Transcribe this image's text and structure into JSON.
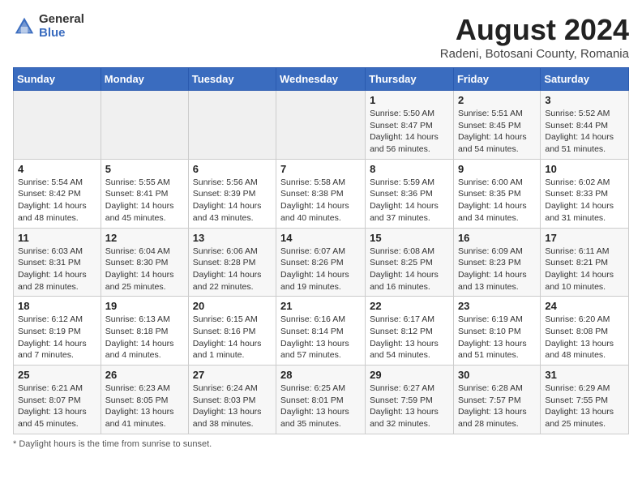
{
  "header": {
    "logo_general": "General",
    "logo_blue": "Blue",
    "main_title": "August 2024",
    "subtitle": "Radeni, Botosani County, Romania"
  },
  "footer": {
    "note": "Daylight hours"
  },
  "calendar": {
    "columns": [
      "Sunday",
      "Monday",
      "Tuesday",
      "Wednesday",
      "Thursday",
      "Friday",
      "Saturday"
    ],
    "weeks": [
      [
        {
          "day": "",
          "info": ""
        },
        {
          "day": "",
          "info": ""
        },
        {
          "day": "",
          "info": ""
        },
        {
          "day": "",
          "info": ""
        },
        {
          "day": "1",
          "info": "Sunrise: 5:50 AM\nSunset: 8:47 PM\nDaylight: 14 hours\nand 56 minutes."
        },
        {
          "day": "2",
          "info": "Sunrise: 5:51 AM\nSunset: 8:45 PM\nDaylight: 14 hours\nand 54 minutes."
        },
        {
          "day": "3",
          "info": "Sunrise: 5:52 AM\nSunset: 8:44 PM\nDaylight: 14 hours\nand 51 minutes."
        }
      ],
      [
        {
          "day": "4",
          "info": "Sunrise: 5:54 AM\nSunset: 8:42 PM\nDaylight: 14 hours\nand 48 minutes."
        },
        {
          "day": "5",
          "info": "Sunrise: 5:55 AM\nSunset: 8:41 PM\nDaylight: 14 hours\nand 45 minutes."
        },
        {
          "day": "6",
          "info": "Sunrise: 5:56 AM\nSunset: 8:39 PM\nDaylight: 14 hours\nand 43 minutes."
        },
        {
          "day": "7",
          "info": "Sunrise: 5:58 AM\nSunset: 8:38 PM\nDaylight: 14 hours\nand 40 minutes."
        },
        {
          "day": "8",
          "info": "Sunrise: 5:59 AM\nSunset: 8:36 PM\nDaylight: 14 hours\nand 37 minutes."
        },
        {
          "day": "9",
          "info": "Sunrise: 6:00 AM\nSunset: 8:35 PM\nDaylight: 14 hours\nand 34 minutes."
        },
        {
          "day": "10",
          "info": "Sunrise: 6:02 AM\nSunset: 8:33 PM\nDaylight: 14 hours\nand 31 minutes."
        }
      ],
      [
        {
          "day": "11",
          "info": "Sunrise: 6:03 AM\nSunset: 8:31 PM\nDaylight: 14 hours\nand 28 minutes."
        },
        {
          "day": "12",
          "info": "Sunrise: 6:04 AM\nSunset: 8:30 PM\nDaylight: 14 hours\nand 25 minutes."
        },
        {
          "day": "13",
          "info": "Sunrise: 6:06 AM\nSunset: 8:28 PM\nDaylight: 14 hours\nand 22 minutes."
        },
        {
          "day": "14",
          "info": "Sunrise: 6:07 AM\nSunset: 8:26 PM\nDaylight: 14 hours\nand 19 minutes."
        },
        {
          "day": "15",
          "info": "Sunrise: 6:08 AM\nSunset: 8:25 PM\nDaylight: 14 hours\nand 16 minutes."
        },
        {
          "day": "16",
          "info": "Sunrise: 6:09 AM\nSunset: 8:23 PM\nDaylight: 14 hours\nand 13 minutes."
        },
        {
          "day": "17",
          "info": "Sunrise: 6:11 AM\nSunset: 8:21 PM\nDaylight: 14 hours\nand 10 minutes."
        }
      ],
      [
        {
          "day": "18",
          "info": "Sunrise: 6:12 AM\nSunset: 8:19 PM\nDaylight: 14 hours\nand 7 minutes."
        },
        {
          "day": "19",
          "info": "Sunrise: 6:13 AM\nSunset: 8:18 PM\nDaylight: 14 hours\nand 4 minutes."
        },
        {
          "day": "20",
          "info": "Sunrise: 6:15 AM\nSunset: 8:16 PM\nDaylight: 14 hours\nand 1 minute."
        },
        {
          "day": "21",
          "info": "Sunrise: 6:16 AM\nSunset: 8:14 PM\nDaylight: 13 hours\nand 57 minutes."
        },
        {
          "day": "22",
          "info": "Sunrise: 6:17 AM\nSunset: 8:12 PM\nDaylight: 13 hours\nand 54 minutes."
        },
        {
          "day": "23",
          "info": "Sunrise: 6:19 AM\nSunset: 8:10 PM\nDaylight: 13 hours\nand 51 minutes."
        },
        {
          "day": "24",
          "info": "Sunrise: 6:20 AM\nSunset: 8:08 PM\nDaylight: 13 hours\nand 48 minutes."
        }
      ],
      [
        {
          "day": "25",
          "info": "Sunrise: 6:21 AM\nSunset: 8:07 PM\nDaylight: 13 hours\nand 45 minutes."
        },
        {
          "day": "26",
          "info": "Sunrise: 6:23 AM\nSunset: 8:05 PM\nDaylight: 13 hours\nand 41 minutes."
        },
        {
          "day": "27",
          "info": "Sunrise: 6:24 AM\nSunset: 8:03 PM\nDaylight: 13 hours\nand 38 minutes."
        },
        {
          "day": "28",
          "info": "Sunrise: 6:25 AM\nSunset: 8:01 PM\nDaylight: 13 hours\nand 35 minutes."
        },
        {
          "day": "29",
          "info": "Sunrise: 6:27 AM\nSunset: 7:59 PM\nDaylight: 13 hours\nand 32 minutes."
        },
        {
          "day": "30",
          "info": "Sunrise: 6:28 AM\nSunset: 7:57 PM\nDaylight: 13 hours\nand 28 minutes."
        },
        {
          "day": "31",
          "info": "Sunrise: 6:29 AM\nSunset: 7:55 PM\nDaylight: 13 hours\nand 25 minutes."
        }
      ]
    ]
  }
}
